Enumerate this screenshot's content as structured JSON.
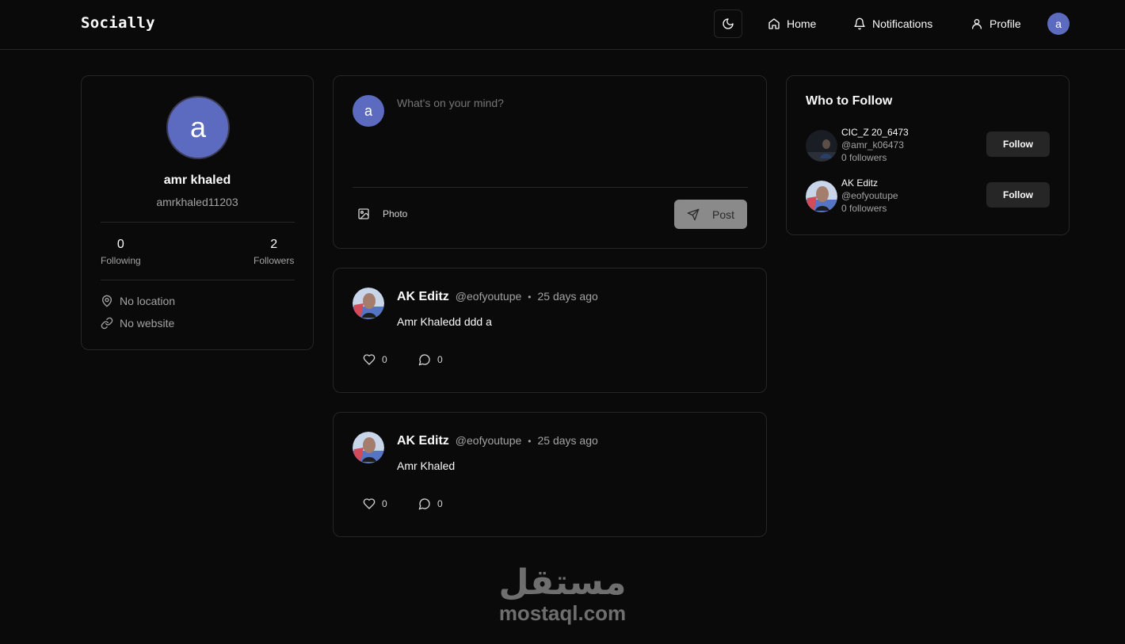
{
  "nav": {
    "brand": "Socially",
    "links": [
      {
        "label": "Home",
        "icon": "home-icon"
      },
      {
        "label": "Notifications",
        "icon": "bell-icon"
      },
      {
        "label": "Profile",
        "icon": "user-icon"
      }
    ],
    "avatar_letter": "a",
    "theme_icon": "moon-icon"
  },
  "colors": {
    "background": "#0a0a0a",
    "border": "#262626",
    "avatar": "#5c6bc0",
    "muted_text": "#a3a3a3"
  },
  "profile": {
    "avatar_letter": "a",
    "name": "amr khaled",
    "username": "amrkhaled11203",
    "following_count": "0",
    "following_label": "Following",
    "followers_count": "2",
    "followers_label": "Followers",
    "location": "No location",
    "website": "No website"
  },
  "composer": {
    "avatar_letter": "a",
    "placeholder": "What's on your mind?",
    "photo_label": "Photo",
    "post_label": "Post"
  },
  "posts": [
    {
      "author": "AK Editz",
      "handle": "@eofyoutupe",
      "separator": "•",
      "time": "25 days ago",
      "content": "Amr Khaledd ddd a",
      "likes": "0",
      "comments": "0"
    },
    {
      "author": "AK Editz",
      "handle": "@eofyoutupe",
      "separator": "•",
      "time": "25 days ago",
      "content": "Amr Khaled",
      "likes": "0",
      "comments": "0"
    }
  ],
  "who_to_follow": {
    "title": "Who to Follow",
    "users": [
      {
        "name": "CIC_Z 20_6473",
        "handle": "@amr_k06473",
        "followers": "0 followers",
        "button": "Follow"
      },
      {
        "name": "AK Editz",
        "handle": "@eofyoutupe",
        "followers": "0 followers",
        "button": "Follow"
      }
    ]
  },
  "watermark": {
    "arabic": "مستقل",
    "latin": "mostaql.com"
  }
}
